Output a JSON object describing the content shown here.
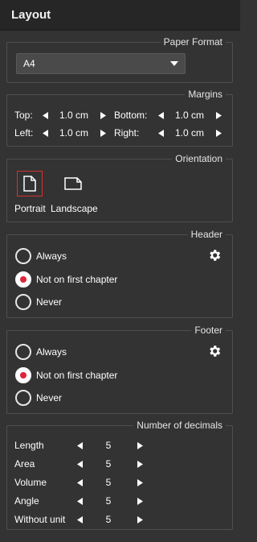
{
  "panel": {
    "title": "Layout"
  },
  "paper_format": {
    "legend": "Paper Format",
    "selected": "A4"
  },
  "margins": {
    "legend": "Margins",
    "top": {
      "label": "Top:",
      "value": "1.0 cm"
    },
    "bottom": {
      "label": "Bottom:",
      "value": "1.0 cm"
    },
    "left": {
      "label": "Left:",
      "value": "1.0 cm"
    },
    "right": {
      "label": "Right:",
      "value": "1.0 cm"
    }
  },
  "orientation": {
    "legend": "Orientation",
    "portrait_label": "Portrait",
    "landscape_label": "Landscape",
    "selected": "portrait"
  },
  "header": {
    "legend": "Header",
    "options": [
      "Always",
      "Not on first chapter",
      "Never"
    ],
    "selected_index": 1
  },
  "footer": {
    "legend": "Footer",
    "options": [
      "Always",
      "Not on first chapter",
      "Never"
    ],
    "selected_index": 1
  },
  "decimals": {
    "legend": "Number of decimals",
    "rows": [
      {
        "label": "Length",
        "value": "5"
      },
      {
        "label": "Area",
        "value": "5"
      },
      {
        "label": "Volume",
        "value": "5"
      },
      {
        "label": "Angle",
        "value": "5"
      },
      {
        "label": "Without unit",
        "value": "5"
      }
    ]
  },
  "colors": {
    "background": "#333333",
    "titlebar": "#262626",
    "accent_red": "#e0243a",
    "border": "#4f4f4f"
  },
  "icons": {
    "arrow_left": "triangle-left-icon",
    "arrow_right": "triangle-right-icon",
    "gear": "gear-icon",
    "portrait": "portrait-page-icon",
    "landscape": "landscape-page-icon"
  }
}
